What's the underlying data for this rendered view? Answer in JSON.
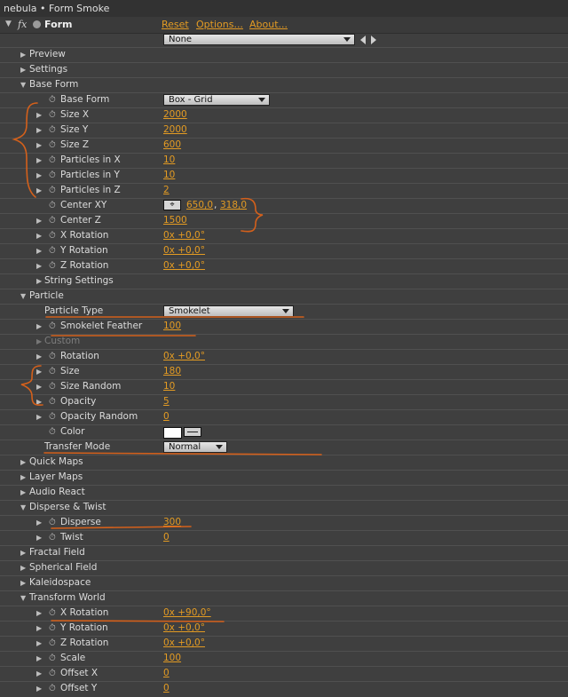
{
  "window": {
    "title": "nebula • Form Smoke"
  },
  "effect": {
    "fx_label": "fx",
    "name": "Form",
    "links": {
      "reset": "Reset",
      "options": "Options...",
      "about": "About..."
    },
    "preset": "None"
  },
  "rows": {
    "preview": "Preview",
    "settings": "Settings",
    "base_form": "Base Form",
    "base_form_type": {
      "label": "Base Form",
      "value": "Box - Grid"
    },
    "size_x": {
      "label": "Size X",
      "value": "2000"
    },
    "size_y": {
      "label": "Size Y",
      "value": "2000"
    },
    "size_z": {
      "label": "Size Z",
      "value": "600"
    },
    "particles_x": {
      "label": "Particles in X",
      "value": "10"
    },
    "particles_y": {
      "label": "Particles in Y",
      "value": "10"
    },
    "particles_z": {
      "label": "Particles in Z",
      "value": "2"
    },
    "center_xy": {
      "label": "Center XY",
      "value_x": "650,0",
      "sep": ",",
      "value_y": "318,0"
    },
    "center_z": {
      "label": "Center Z",
      "value": "1500"
    },
    "x_rotation": {
      "label": "X Rotation",
      "value": "0x +0,0°"
    },
    "y_rotation": {
      "label": "Y Rotation",
      "value": "0x +0,0°"
    },
    "z_rotation": {
      "label": "Z Rotation",
      "value": "0x +0,0°"
    },
    "string_settings": "String Settings",
    "particle": "Particle",
    "particle_type": {
      "label": "Particle Type",
      "value": "Smokelet"
    },
    "smokelet_feather": {
      "label": "Smokelet Feather",
      "value": "100"
    },
    "custom": "Custom",
    "p_rotation": {
      "label": "Rotation",
      "value": "0x +0,0°"
    },
    "size": {
      "label": "Size",
      "value": "180"
    },
    "size_random": {
      "label": "Size Random",
      "value": "10"
    },
    "opacity": {
      "label": "Opacity",
      "value": "5"
    },
    "opacity_random": {
      "label": "Opacity Random",
      "value": "0"
    },
    "color": {
      "label": "Color",
      "swatch": "#ffffff"
    },
    "transfer_mode": {
      "label": "Transfer Mode",
      "value": "Normal"
    },
    "quick_maps": "Quick Maps",
    "layer_maps": "Layer Maps",
    "audio_react": "Audio React",
    "disperse_twist": "Disperse & Twist",
    "disperse": {
      "label": "Disperse",
      "value": "300"
    },
    "twist": {
      "label": "Twist",
      "value": "0"
    },
    "fractal_field": "Fractal Field",
    "spherical_field": "Spherical Field",
    "kaleidospace": "Kaleidospace",
    "transform_world": "Transform World",
    "tw_x_rotation": {
      "label": "X Rotation",
      "value": "0x +90,0°"
    },
    "tw_y_rotation": {
      "label": "Y Rotation",
      "value": "0x +0,0°"
    },
    "tw_z_rotation": {
      "label": "Z Rotation",
      "value": "0x +0,0°"
    },
    "scale": {
      "label": "Scale",
      "value": "100"
    },
    "offset_x": {
      "label": "Offset X",
      "value": "0"
    },
    "offset_y": {
      "label": "Offset Y",
      "value": "0"
    }
  },
  "colors": {
    "value": "#e39b23",
    "annotation": "#d4601b",
    "background": "#3f3f3f"
  }
}
